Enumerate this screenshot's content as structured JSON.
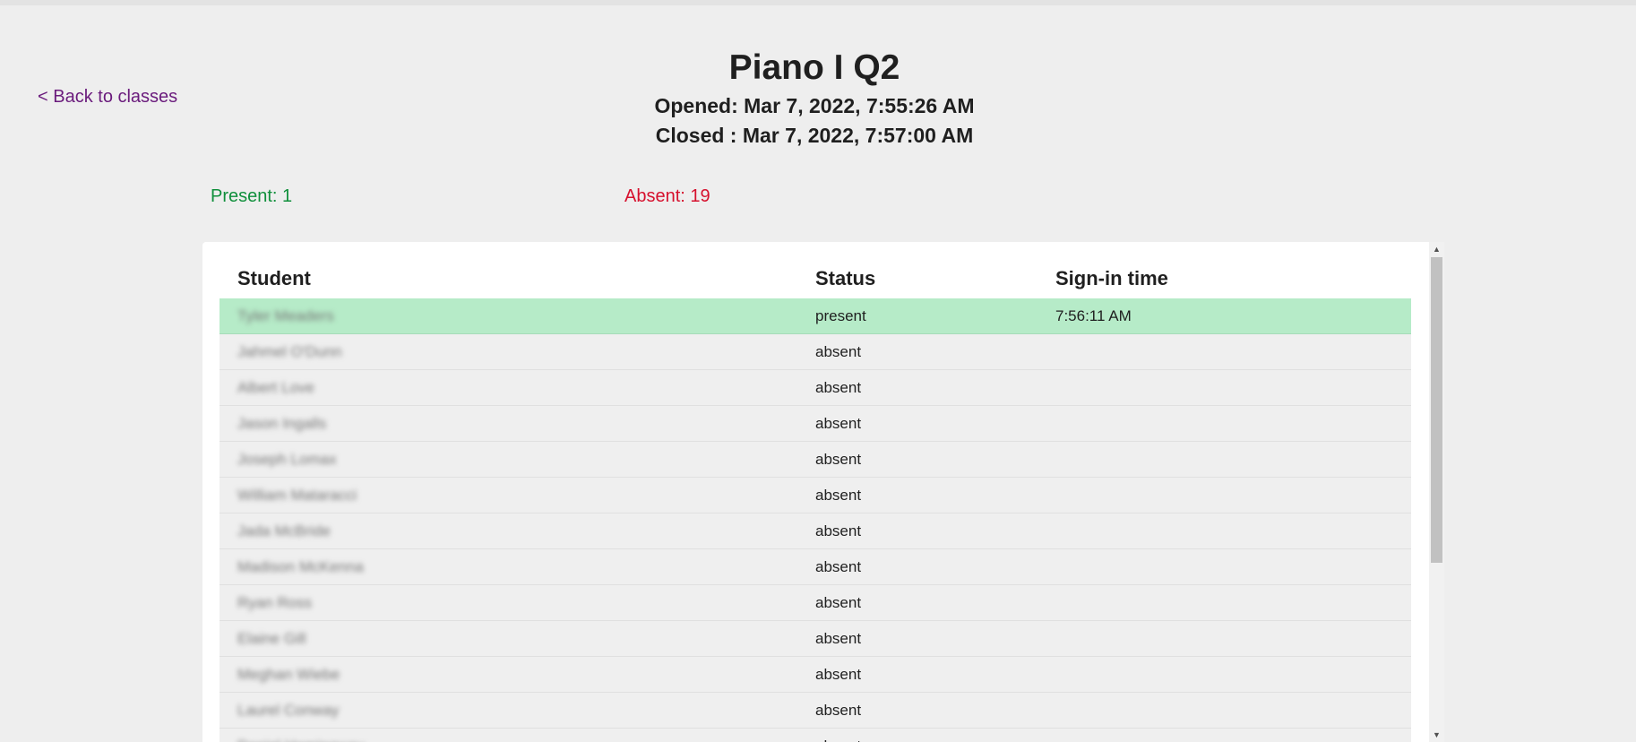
{
  "nav": {
    "back_label": "< Back to classes"
  },
  "header": {
    "title": "Piano I Q2",
    "opened": "Opened: Mar 7, 2022, 7:55:26 AM",
    "closed": "Closed : Mar 7, 2022, 7:57:00 AM"
  },
  "summary": {
    "present": "Present: 1",
    "absent": "Absent: 19"
  },
  "colors": {
    "present_text": "#0f8f3b",
    "absent_text": "#d6102d",
    "link": "#6a1b7c",
    "present_row": "#b6ebc8"
  },
  "table": {
    "columns": [
      "Student",
      "Status",
      "Sign-in time"
    ],
    "rows": [
      {
        "student": "Tyler Meaders",
        "status": "present",
        "signin": "7:56:11 AM"
      },
      {
        "student": "Jahmel O'Dunn",
        "status": "absent",
        "signin": ""
      },
      {
        "student": "Albert Love",
        "status": "absent",
        "signin": ""
      },
      {
        "student": "Jason Ingalls",
        "status": "absent",
        "signin": ""
      },
      {
        "student": "Joseph Lomax",
        "status": "absent",
        "signin": ""
      },
      {
        "student": "William Mataracci",
        "status": "absent",
        "signin": ""
      },
      {
        "student": "Jada McBride",
        "status": "absent",
        "signin": ""
      },
      {
        "student": "Madison McKenna",
        "status": "absent",
        "signin": ""
      },
      {
        "student": "Ryan Ross",
        "status": "absent",
        "signin": ""
      },
      {
        "student": "Elaine Gill",
        "status": "absent",
        "signin": ""
      },
      {
        "student": "Meghan Wiebe",
        "status": "absent",
        "signin": ""
      },
      {
        "student": "Laurel Conway",
        "status": "absent",
        "signin": ""
      },
      {
        "student": "Daniel Hemingway",
        "status": "absent",
        "signin": ""
      }
    ]
  }
}
